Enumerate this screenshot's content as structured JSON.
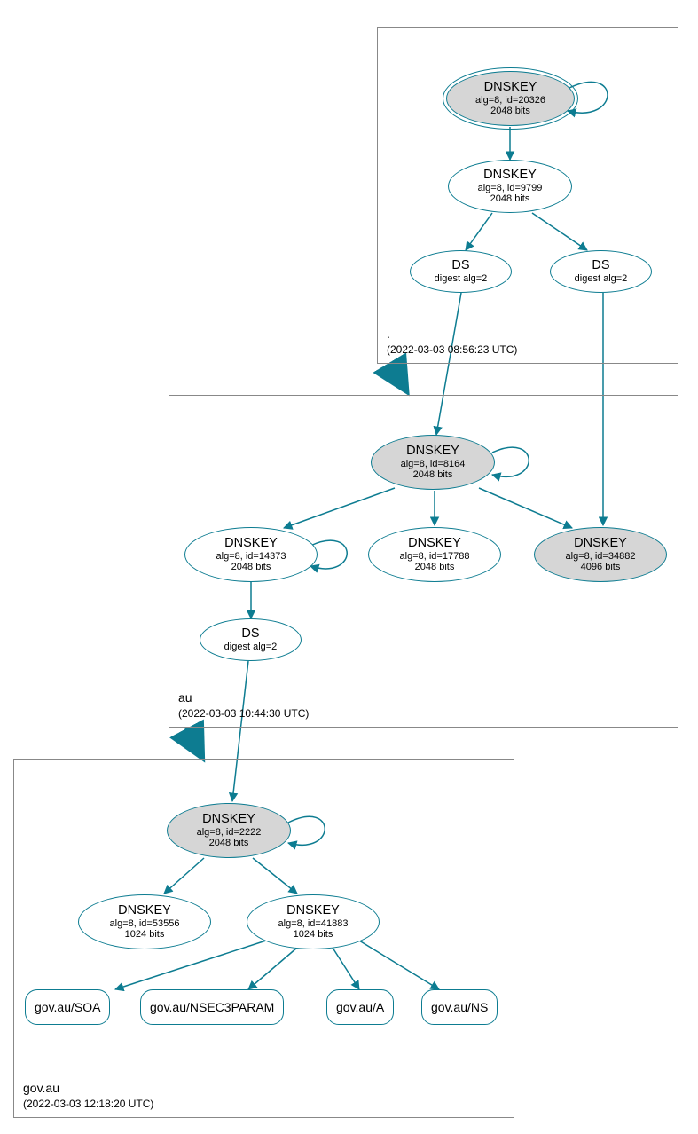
{
  "zones": {
    "root": {
      "name": ".",
      "ts": "(2022-03-03 08:56:23 UTC)"
    },
    "au": {
      "name": "au",
      "ts": "(2022-03-03 10:44:30 UTC)"
    },
    "gov": {
      "name": "gov.au",
      "ts": "(2022-03-03 12:18:20 UTC)"
    }
  },
  "nodes": {
    "root_ksk": {
      "title": "DNSKEY",
      "sub1": "alg=8, id=20326",
      "sub2": "2048 bits"
    },
    "root_zsk": {
      "title": "DNSKEY",
      "sub1": "alg=8, id=9799",
      "sub2": "2048 bits"
    },
    "root_ds1": {
      "title": "DS",
      "sub1": "digest alg=2"
    },
    "root_ds2": {
      "title": "DS",
      "sub1": "digest alg=2"
    },
    "au_ksk": {
      "title": "DNSKEY",
      "sub1": "alg=8, id=8164",
      "sub2": "2048 bits"
    },
    "au_zsk1": {
      "title": "DNSKEY",
      "sub1": "alg=8, id=14373",
      "sub2": "2048 bits"
    },
    "au_zsk2": {
      "title": "DNSKEY",
      "sub1": "alg=8, id=17788",
      "sub2": "2048 bits"
    },
    "au_zsk3": {
      "title": "DNSKEY",
      "sub1": "alg=8, id=34882",
      "sub2": "4096 bits"
    },
    "au_ds": {
      "title": "DS",
      "sub1": "digest alg=2"
    },
    "gov_ksk": {
      "title": "DNSKEY",
      "sub1": "alg=8, id=2222",
      "sub2": "2048 bits"
    },
    "gov_zsk1": {
      "title": "DNSKEY",
      "sub1": "alg=8, id=53556",
      "sub2": "1024 bits"
    },
    "gov_zsk2": {
      "title": "DNSKEY",
      "sub1": "alg=8, id=41883",
      "sub2": "1024 bits"
    }
  },
  "rr": {
    "soa": "gov.au/SOA",
    "nsec3": "gov.au/NSEC3PARAM",
    "a": "gov.au/A",
    "ns": "gov.au/NS"
  },
  "colors": {
    "stroke": "#0d7c91",
    "fill": "#d6d6d6"
  }
}
